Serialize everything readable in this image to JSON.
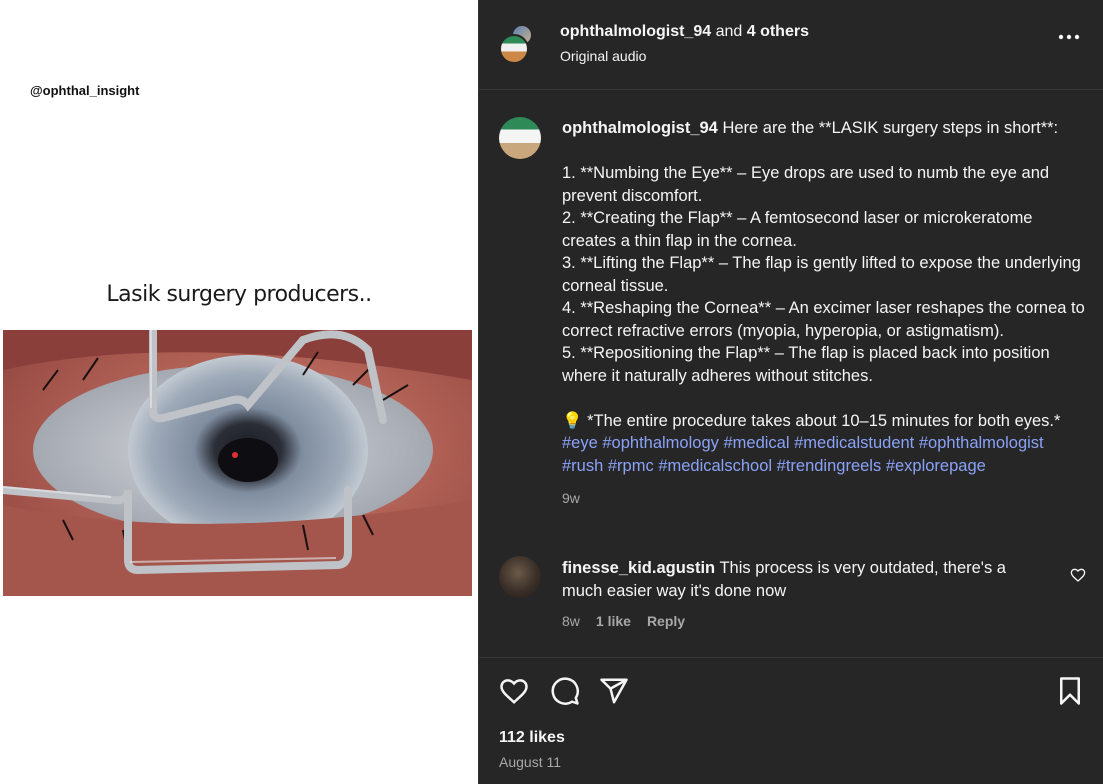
{
  "media": {
    "watermark": "@ophthal_insight",
    "overlay_caption": "Lasik surgery producers.."
  },
  "header": {
    "username": "ophthalmologist_94",
    "and_text": "and",
    "others": "4 others",
    "subtitle": "Original audio",
    "more_icon": "more-horizontal-icon"
  },
  "caption": {
    "username": "ophthalmologist_94",
    "intro": "Here are the **LASIK surgery steps in short**:",
    "steps": [
      "1. **Numbing the Eye** – Eye drops are used to numb the eye and prevent discomfort.",
      "2. **Creating the Flap** – A femtosecond laser or microkeratome creates a thin flap in the cornea.",
      "3. **Lifting the Flap** – The flap is gently lifted to expose the underlying corneal tissue.",
      "4. **Reshaping the Cornea** – An excimer laser reshapes the cornea to correct refractive errors (myopia, hyperopia, or astigmatism).",
      "5. **Repositioning the Flap** – The flap is placed back into position where it naturally adheres without stitches."
    ],
    "note": "💡 *The entire procedure takes about 10–15 minutes for both eyes.*",
    "hashtags": [
      "#eye",
      "#ophthalmology",
      "#medical",
      "#medicalstudent",
      "#ophthalmologist",
      "#rush",
      "#rpmc",
      "#medicalschool",
      "#trendingreels",
      "#explorepage"
    ],
    "time": "9w"
  },
  "comment": {
    "username": "finesse_kid.agustin",
    "text": "This process is very outdated, there's a much easier way it's done now",
    "time": "8w",
    "likes": "1 like",
    "reply": "Reply"
  },
  "footer": {
    "likes": "112 likes",
    "date": "August 11"
  },
  "colors": {
    "panel_bg": "#262626",
    "hashtag": "#8aa2f8",
    "muted": "#a8a8a8"
  }
}
